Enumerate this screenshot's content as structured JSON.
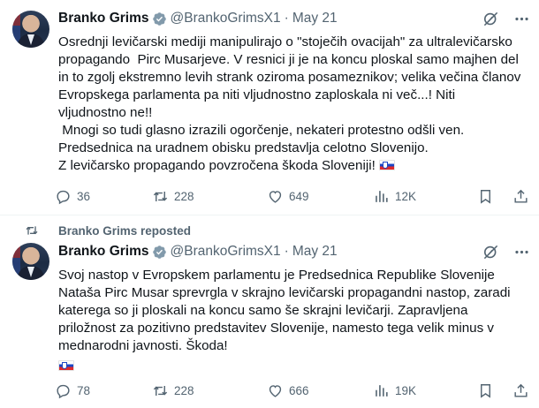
{
  "tweets": [
    {
      "author": "Branko Grims",
      "handle": "@BrankoGrimsX1",
      "separator": "·",
      "date": "May 21",
      "text": "Osrednji levičarski mediji manipulirajo o \"stoječih ovacijah\" za ultralevičarsko propagando  Pirc Musarjeve. V resnici ji je na koncu ploskal samo majhen del in to zgolj ekstremno levih strank oziroma posameznikov; velika večina članov Evropskega parlamenta pa niti vljudnostno zaploskala ni več...! Niti vljudnostno ne!!\n Mnogi so tudi glasno izrazili ogorčenje, nekateri protestno odšli ven. Predsednica na uradnem obisku predstavlja celotno Slovenijo.\nZ levičarsko propagando povzročena škoda Sloveniji! ",
      "replies": "36",
      "reposts": "228",
      "likes": "649",
      "views": "12K"
    },
    {
      "author": "Branko Grims",
      "handle": "@BrankoGrimsX1",
      "separator": "·",
      "date": "May 21",
      "text": "Svoj nastop v Evropskem parlamentu je Predsednica Republike Slovenije Nataša Pirc Musar sprevrgla v skrajno levičarski propagandni nastop, zaradi katerega so ji ploskali na koncu samo še skrajni levičarji. Zapravljena priložnost za pozitivno predstavitev Slovenije, namesto tega velik minus v mednarodni javnosti. Škoda!",
      "replies": "78",
      "reposts": "228",
      "likes": "666",
      "views": "19K"
    }
  ],
  "repost_banner": "Branko Grims reposted",
  "colors": {
    "text": "#0f1419",
    "muted": "#536471",
    "verified": "#829aab",
    "divider": "#eff3f4"
  },
  "icons": [
    "verified-badge-icon",
    "grok-icon",
    "more-icon",
    "reply-icon",
    "repost-icon",
    "like-icon",
    "views-icon",
    "bookmark-icon",
    "share-icon",
    "slovenia-flag-icon"
  ]
}
